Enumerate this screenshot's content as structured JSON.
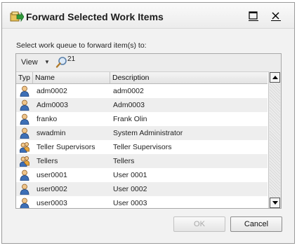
{
  "dialog": {
    "title": "Forward Selected Work Items",
    "prompt": "Select work queue to forward item(s) to:",
    "toolbar": {
      "view_label": "View",
      "search_count": "21"
    },
    "columns": {
      "type": "Typ",
      "name": "Name",
      "description": "Description"
    },
    "rows": [
      {
        "icon": "user-icon",
        "name": "adm0002",
        "description": "adm0002"
      },
      {
        "icon": "user-icon",
        "name": "Adm0003",
        "description": "Adm0003"
      },
      {
        "icon": "user-icon",
        "name": "franko",
        "description": "Frank Olin"
      },
      {
        "icon": "user-icon",
        "name": "swadmin",
        "description": "System Administrator"
      },
      {
        "icon": "group-icon",
        "name": "Teller Supervisors",
        "description": "Teller Supervisors"
      },
      {
        "icon": "group-icon",
        "name": "Tellers",
        "description": "Tellers"
      },
      {
        "icon": "user-icon",
        "name": "user0001",
        "description": "User 0001"
      },
      {
        "icon": "user-icon",
        "name": "user0002",
        "description": "User 0002"
      },
      {
        "icon": "user-icon",
        "name": "user0003",
        "description": "User 0003"
      }
    ],
    "buttons": {
      "ok": "OK",
      "cancel": "Cancel"
    }
  },
  "colors": {
    "accent": "#2a74c0",
    "disabled_text": "#a8a8a8"
  }
}
